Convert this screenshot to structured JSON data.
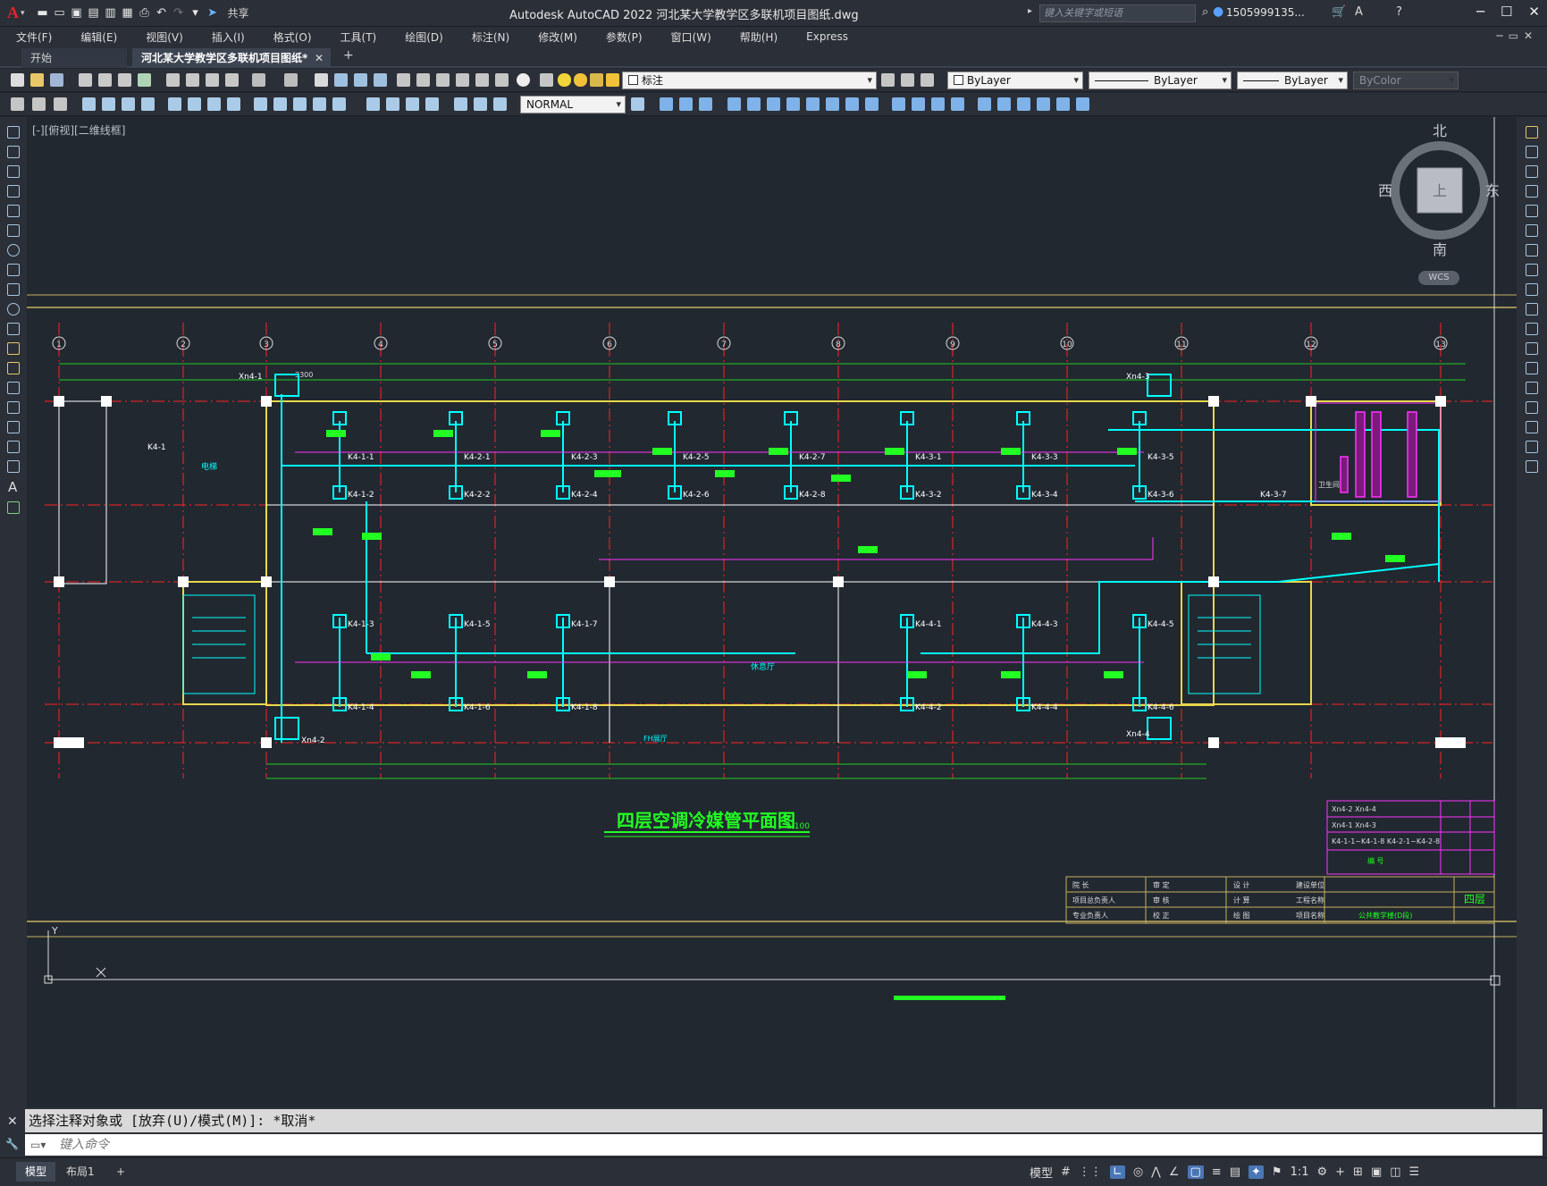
{
  "app": {
    "title": "Autodesk AutoCAD 2022    河北某大学教学区多联机项目图纸.dwg",
    "logo": "A",
    "share_label": "共享",
    "search_placeholder": "键入关键字或短语",
    "user": "1505999135...",
    "window_buttons": [
      "─",
      "☐",
      "✕"
    ]
  },
  "menu": [
    "文件(F)",
    "编辑(E)",
    "视图(V)",
    "插入(I)",
    "格式(O)",
    "工具(T)",
    "绘图(D)",
    "标注(N)",
    "修改(M)",
    "参数(P)",
    "窗口(W)",
    "帮助(H)",
    "Express"
  ],
  "tabs": {
    "start": "开始",
    "active": "河北某大学教学区多联机项目图纸*",
    "add": "+"
  },
  "toolbar": {
    "layer_name": "标注",
    "color": "ByLayer",
    "linetype": "ByLayer",
    "lineweight": "ByLayer",
    "plotstyle": "ByColor",
    "textstyle": "NORMAL"
  },
  "view": {
    "label": "[-][俯视][二维线框]"
  },
  "viewcube": {
    "n": "北",
    "s": "南",
    "e": "东",
    "w": "西",
    "face": "上",
    "wcs": "WCS"
  },
  "drawing": {
    "title": "四层空调冷媒管平面图",
    "scale": "1:100",
    "grid_bubbles": [
      "1",
      "2",
      "3",
      "4",
      "5",
      "6",
      "7",
      "8",
      "9",
      "10",
      "11",
      "12",
      "13"
    ],
    "room_labels": [
      "电梯",
      "休息厅",
      "FH展厅",
      "卫生间"
    ],
    "unit_tags_top": [
      "K4-1-1",
      "K4-2-1",
      "K4-2-3",
      "K4-2-5",
      "K4-2-7",
      "K4-3-1",
      "K4-3-3",
      "K4-3-5",
      "K4-3-7"
    ],
    "unit_tags_mid": [
      "K4-1-2",
      "K4-2-2",
      "K4-2-4",
      "K4-2-6",
      "K4-2-8",
      "K4-3-2",
      "K4-3-4",
      "K4-3-6"
    ],
    "unit_tags_lower": [
      "K4-1-3",
      "K4-1-5",
      "K4-1-7",
      "K4-4-1",
      "K4-4-3",
      "K4-4-5"
    ],
    "unit_tags_bottom": [
      "K4-1-4",
      "K4-1-6",
      "K4-1-8",
      "K4-4-2",
      "K4-4-4",
      "K4-4-6"
    ],
    "outdoor_tags": [
      "Xn4-1",
      "Xn4-2",
      "Xn4-3",
      "Xn4-4",
      "K4-1"
    ],
    "dim_top": "3300"
  },
  "titleblock": {
    "legend_rows": [
      "Xn4-2  Xn4-4",
      "Xn4-1  Xn4-3",
      "K4-1-1~K4-1-8  K4-2-1~K4-2-8",
      "编    号"
    ],
    "cells": [
      "院    长",
      "审    定",
      "设    计",
      "建设单位",
      "项目总负责人",
      "审    核",
      "计    算",
      "工程名称",
      "专业负责人",
      "校    正",
      "绘    图",
      "项目名称",
      "公共教学楼(D段)",
      "四层"
    ]
  },
  "command": {
    "history": "选择注释对象或 [放弃(U)/模式(M)]: *取消*",
    "placeholder": "键入命令"
  },
  "status": {
    "model": "模型",
    "layout": "布局1",
    "add": "+",
    "model_label": "模型",
    "scale": "1:1"
  },
  "colors": {
    "cyan": "#00ffff",
    "magenta": "#ff33ff",
    "green": "#22ff22",
    "yellow": "#ffff00",
    "red": "#ff2222",
    "white": "#ffffff"
  }
}
